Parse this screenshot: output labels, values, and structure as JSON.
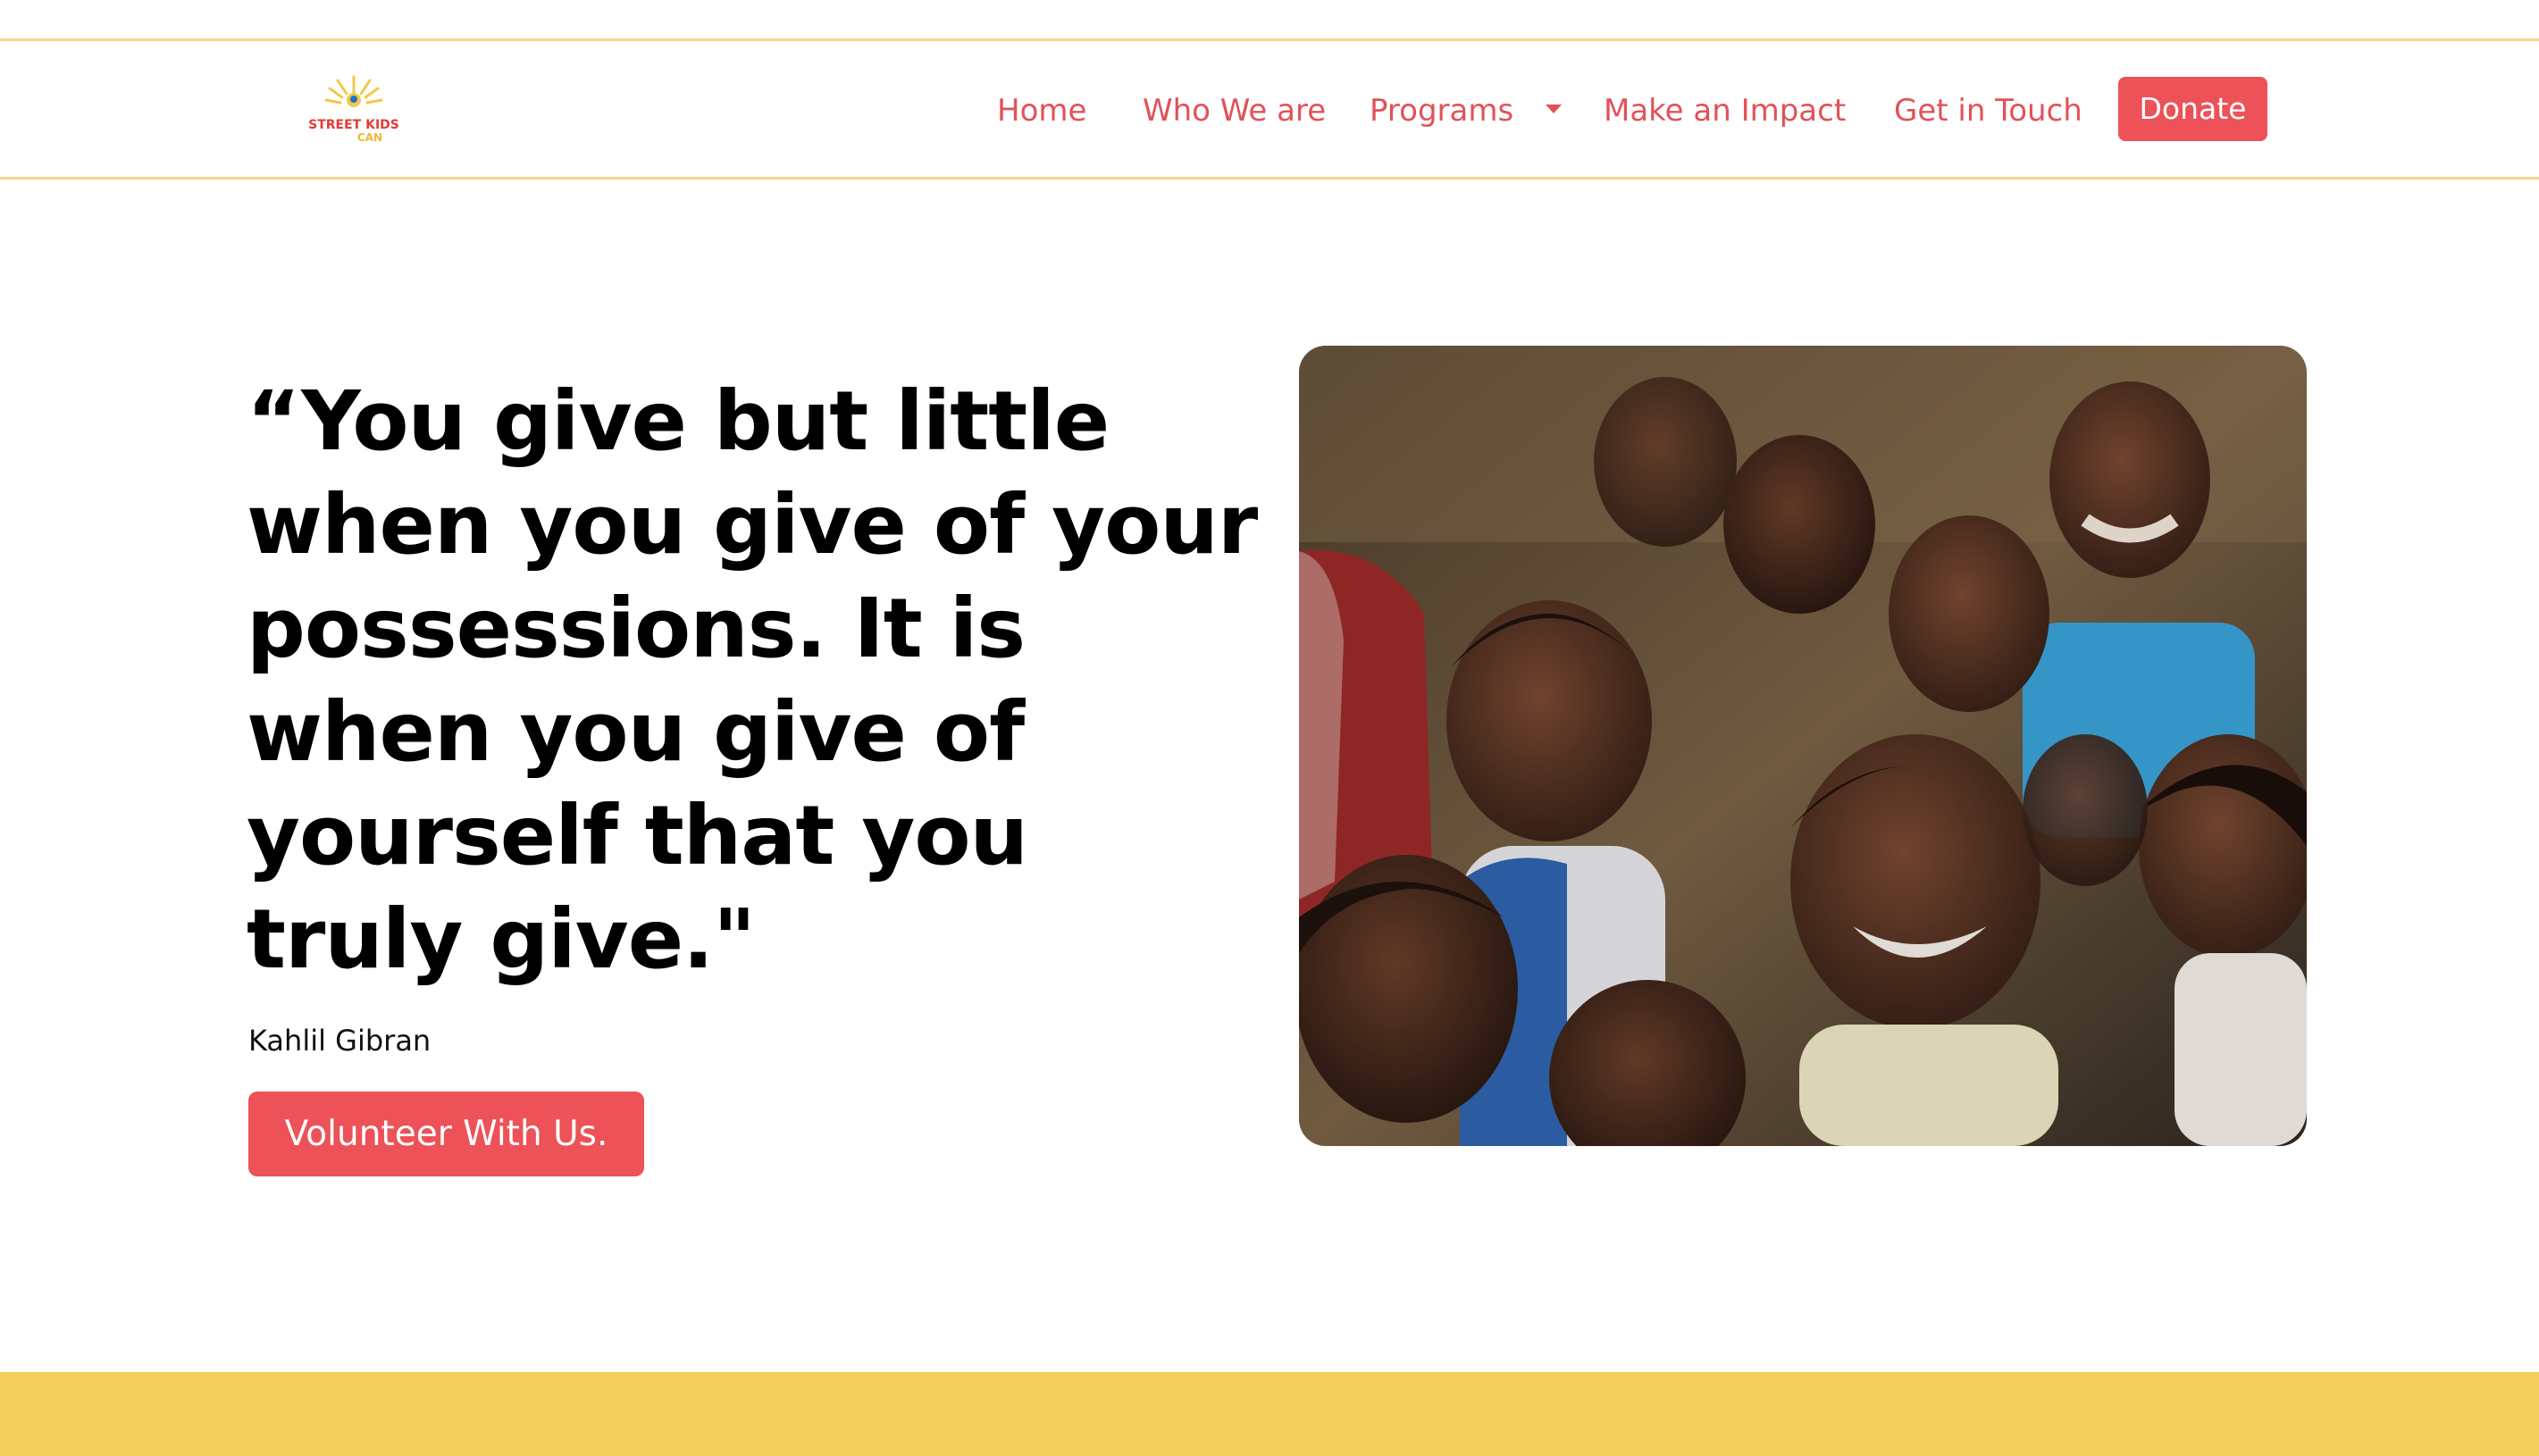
{
  "brand": {
    "logo_text_line1": "STREET KIDS",
    "logo_text_line2": "CAN",
    "logo_icon": "sunburst-logo-icon"
  },
  "nav": {
    "home": "Home",
    "who_we_are": "Who We are",
    "programs": "Programs",
    "programs_caret_icon": "caret-down-icon",
    "make_an_impact": "Make an Impact",
    "get_in_touch": "Get in Touch",
    "donate": "Donate"
  },
  "hero": {
    "quote": "“You give but little when you give of your possessions. It is when you give of yourself that you truly give.\"",
    "author": "Kahlil Gibran",
    "cta": "Volunteer With Us."
  },
  "colors": {
    "accent": "#ec5257",
    "nav_text": "#e25258",
    "border_yellow": "#f3d88c",
    "footer_yellow": "#f3cf5b"
  }
}
